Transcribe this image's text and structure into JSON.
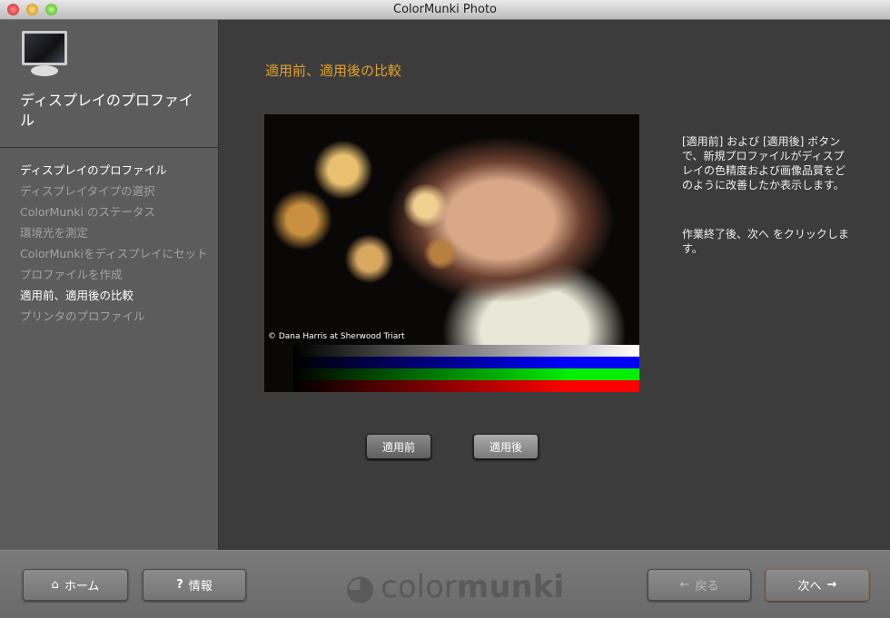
{
  "window": {
    "title": "ColorMunki Photo"
  },
  "sidebar": {
    "title": "ディスプレイのプロファイル",
    "steps": [
      {
        "label": "ディスプレイのプロファイル"
      },
      {
        "label": "ディスプレイタイプの選択"
      },
      {
        "label": "ColorMunki のステータス"
      },
      {
        "label": "環境光を測定"
      },
      {
        "label": "ColorMunkiをディスプレイにセット"
      },
      {
        "label": "プロファイルを作成"
      },
      {
        "label": "適用前、適用後の比較"
      },
      {
        "label": "プリンタのプロファイル"
      }
    ]
  },
  "main": {
    "heading": "適用前、適用後の比較",
    "photo_caption": "© Dana Harris at Sherwood Triart",
    "description": "[適用前] および [適用後] ボタンで、新規プロファイルがディスプレイの色精度および画像品質をどのように改善したか表示します。",
    "instruction": "作業終了後、次へ をクリックします。",
    "before_label": "適用前",
    "after_label": "適用後"
  },
  "footer": {
    "home_label": "ホーム",
    "info_label": "情報",
    "logo_light": "color",
    "logo_bold": "munki",
    "back_label": "戻る",
    "next_label": "次へ"
  },
  "colors": {
    "accent": "#e0a02a"
  }
}
